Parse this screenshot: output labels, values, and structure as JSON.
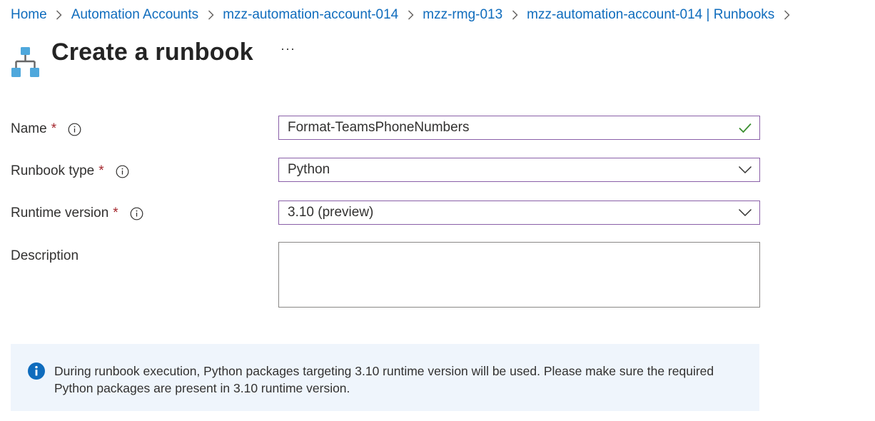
{
  "breadcrumb": {
    "items": [
      "Home",
      "Automation Accounts",
      "mzz-automation-account-014",
      "mzz-rmg-013",
      "mzz-automation-account-014 | Runbooks"
    ]
  },
  "header": {
    "icon": "runbook-hierarchy-icon",
    "title": "Create a runbook",
    "more_label": "···"
  },
  "form": {
    "required_marker": "*",
    "name": {
      "label": "Name",
      "value": "Format-TeamsPhoneNumbers",
      "valid_icon": "checkmark-icon"
    },
    "runbook_type": {
      "label": "Runbook type",
      "value": "Python"
    },
    "runtime_version": {
      "label": "Runtime version",
      "value": "3.10 (preview)"
    },
    "description": {
      "label": "Description",
      "value": ""
    }
  },
  "info_banner": {
    "icon": "info-filled-icon",
    "text": "During runbook execution, Python packages targeting 3.10 runtime version will be used. Please make sure the required Python packages are present in 3.10 runtime version."
  },
  "colors": {
    "link": "#0f6cbd",
    "required": "#a4262c",
    "active_border": "#8a5fa8",
    "success": "#3a8f2f",
    "info_bg": "#eff5fc",
    "info_icon": "#0f6cbd",
    "icon_blue": "#4fa8dc"
  }
}
